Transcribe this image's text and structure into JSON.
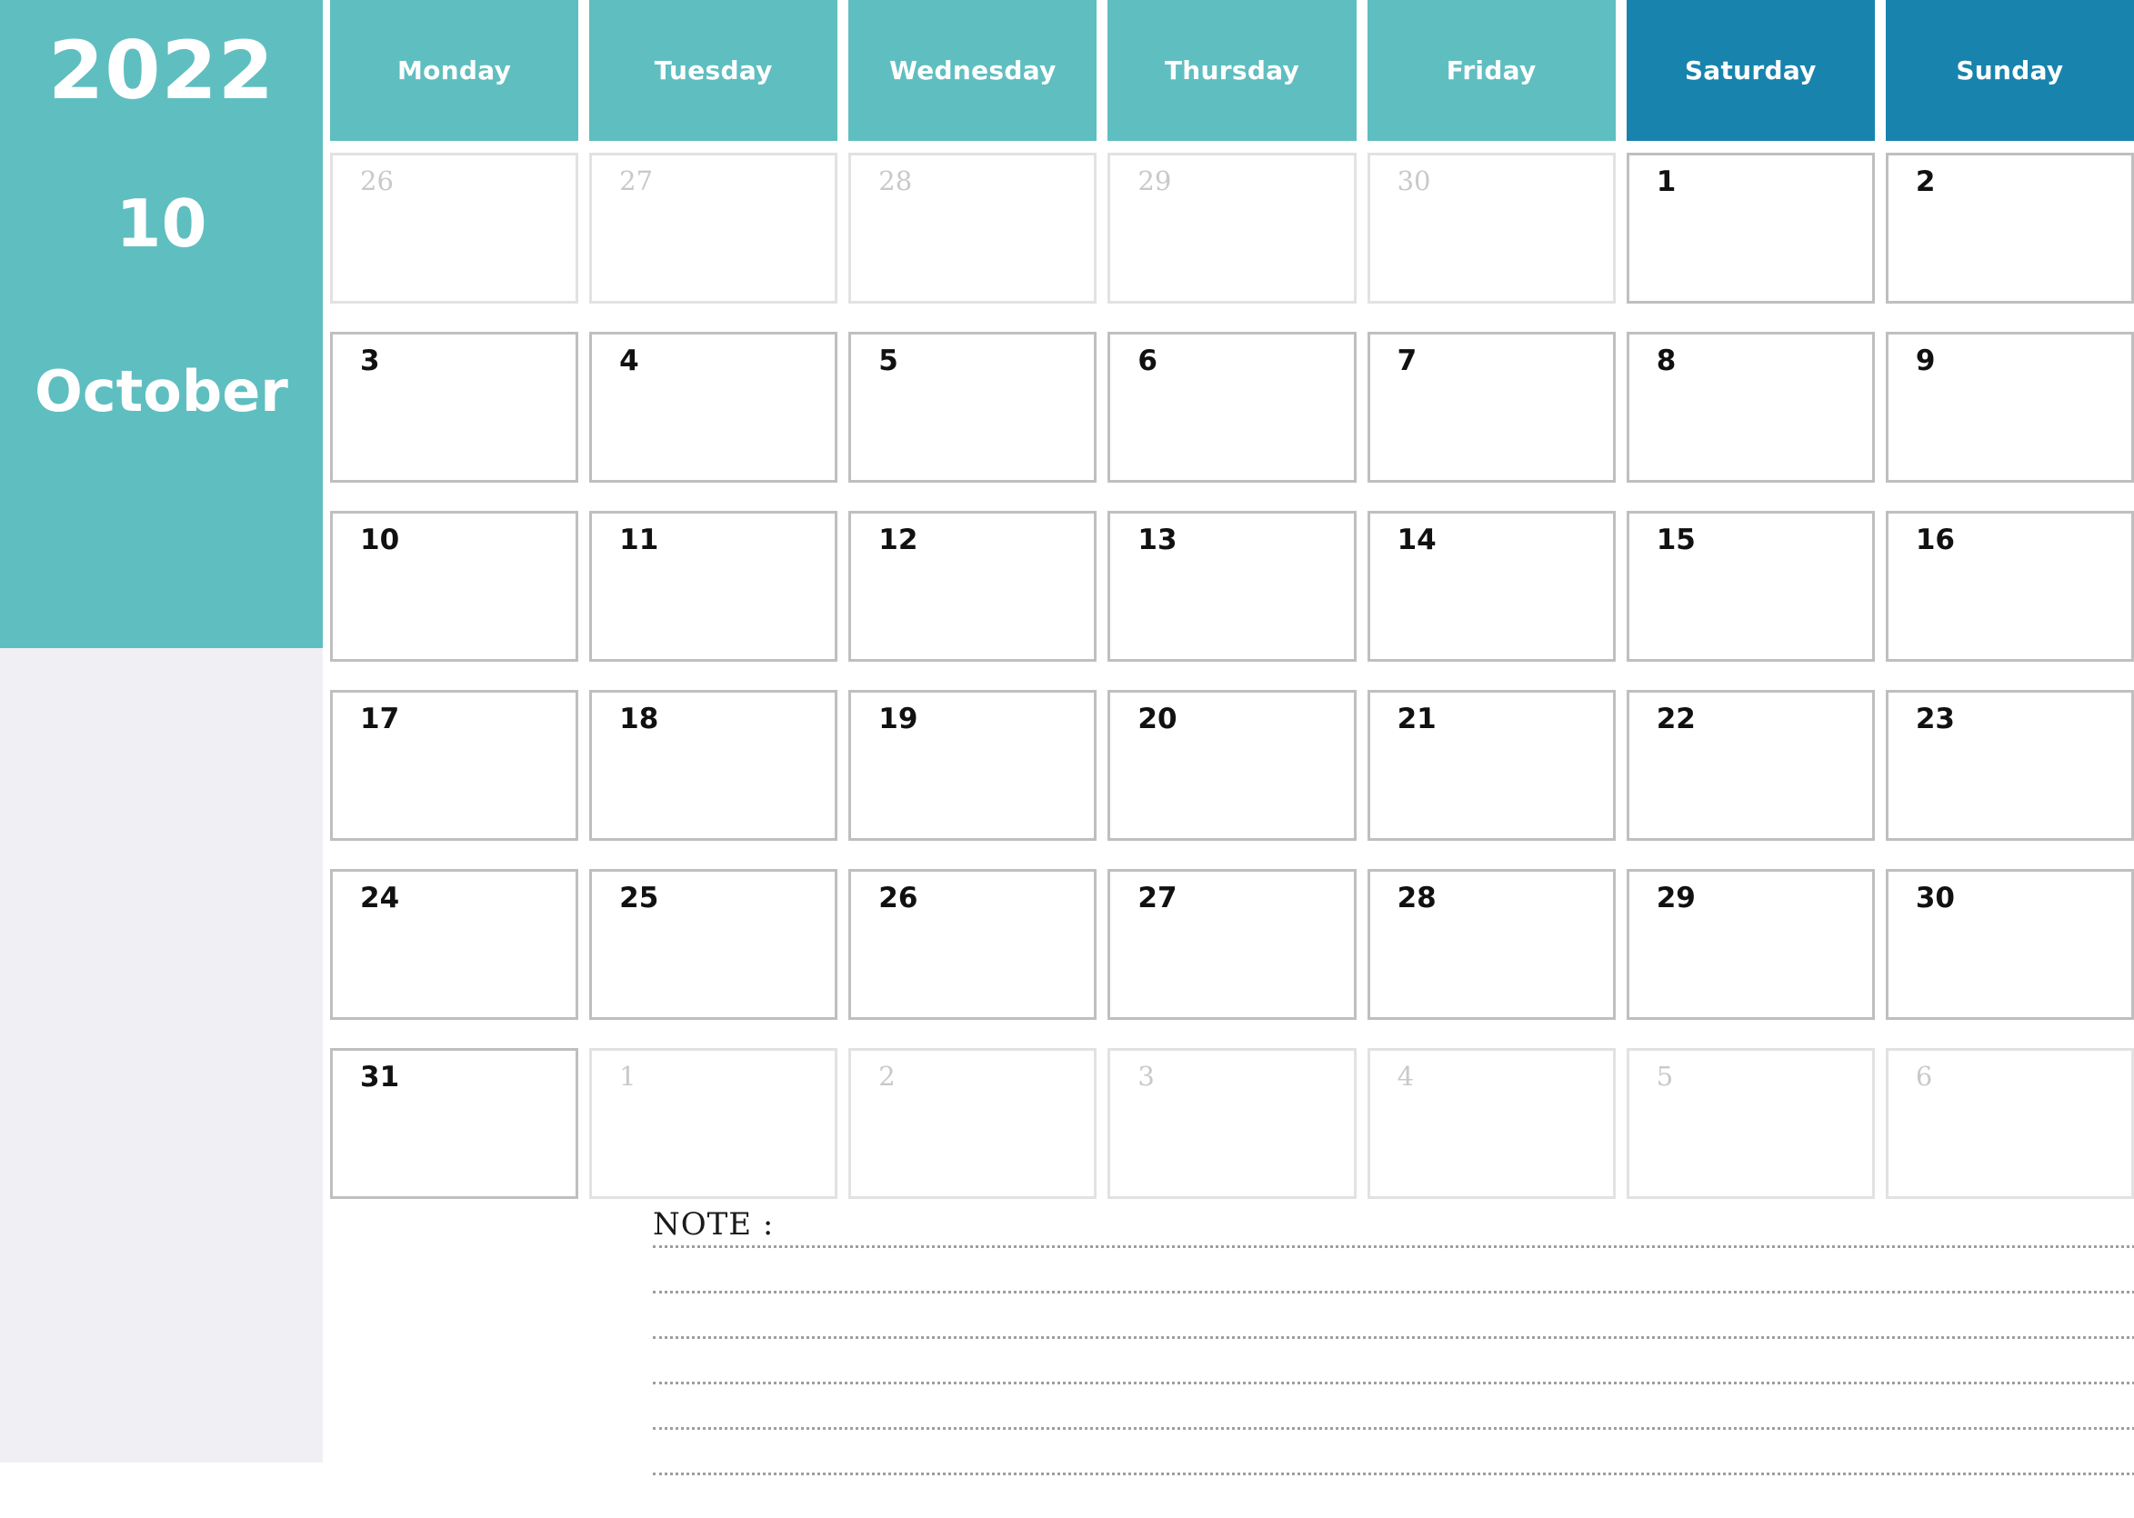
{
  "sidebar": {
    "year": "2022",
    "month_number": "10",
    "month_name": "October",
    "background_color": "#5fbec0",
    "page_background_color": "#f0eff4"
  },
  "calendar": {
    "weekday_headers": [
      {
        "label": "Monday",
        "type": "weekday"
      },
      {
        "label": "Tuesday",
        "type": "weekday"
      },
      {
        "label": "Wednesday",
        "type": "weekday"
      },
      {
        "label": "Thursday",
        "type": "weekday"
      },
      {
        "label": "Friday",
        "type": "weekday"
      },
      {
        "label": "Saturday",
        "type": "weekend"
      },
      {
        "label": "Sunday",
        "type": "weekend"
      }
    ],
    "weekday_color": "#5fbec0",
    "weekend_color": "#1883ad",
    "weeks": [
      [
        {
          "day": "26",
          "in_month": false
        },
        {
          "day": "27",
          "in_month": false
        },
        {
          "day": "28",
          "in_month": false
        },
        {
          "day": "29",
          "in_month": false
        },
        {
          "day": "30",
          "in_month": false
        },
        {
          "day": "1",
          "in_month": true
        },
        {
          "day": "2",
          "in_month": true
        }
      ],
      [
        {
          "day": "3",
          "in_month": true
        },
        {
          "day": "4",
          "in_month": true
        },
        {
          "day": "5",
          "in_month": true
        },
        {
          "day": "6",
          "in_month": true
        },
        {
          "day": "7",
          "in_month": true
        },
        {
          "day": "8",
          "in_month": true
        },
        {
          "day": "9",
          "in_month": true
        }
      ],
      [
        {
          "day": "10",
          "in_month": true
        },
        {
          "day": "11",
          "in_month": true
        },
        {
          "day": "12",
          "in_month": true
        },
        {
          "day": "13",
          "in_month": true
        },
        {
          "day": "14",
          "in_month": true
        },
        {
          "day": "15",
          "in_month": true
        },
        {
          "day": "16",
          "in_month": true
        }
      ],
      [
        {
          "day": "17",
          "in_month": true
        },
        {
          "day": "18",
          "in_month": true
        },
        {
          "day": "19",
          "in_month": true
        },
        {
          "day": "20",
          "in_month": true
        },
        {
          "day": "21",
          "in_month": true
        },
        {
          "day": "22",
          "in_month": true
        },
        {
          "day": "23",
          "in_month": true
        }
      ],
      [
        {
          "day": "24",
          "in_month": true
        },
        {
          "day": "25",
          "in_month": true
        },
        {
          "day": "26",
          "in_month": true
        },
        {
          "day": "27",
          "in_month": true
        },
        {
          "day": "28",
          "in_month": true
        },
        {
          "day": "29",
          "in_month": true
        },
        {
          "day": "30",
          "in_month": true
        }
      ],
      [
        {
          "day": "31",
          "in_month": true
        },
        {
          "day": "1",
          "in_month": false
        },
        {
          "day": "2",
          "in_month": false
        },
        {
          "day": "3",
          "in_month": false
        },
        {
          "day": "4",
          "in_month": false
        },
        {
          "day": "5",
          "in_month": false
        },
        {
          "day": "6",
          "in_month": false
        }
      ]
    ]
  },
  "note": {
    "label": "NOTE :",
    "line_count": 6
  }
}
